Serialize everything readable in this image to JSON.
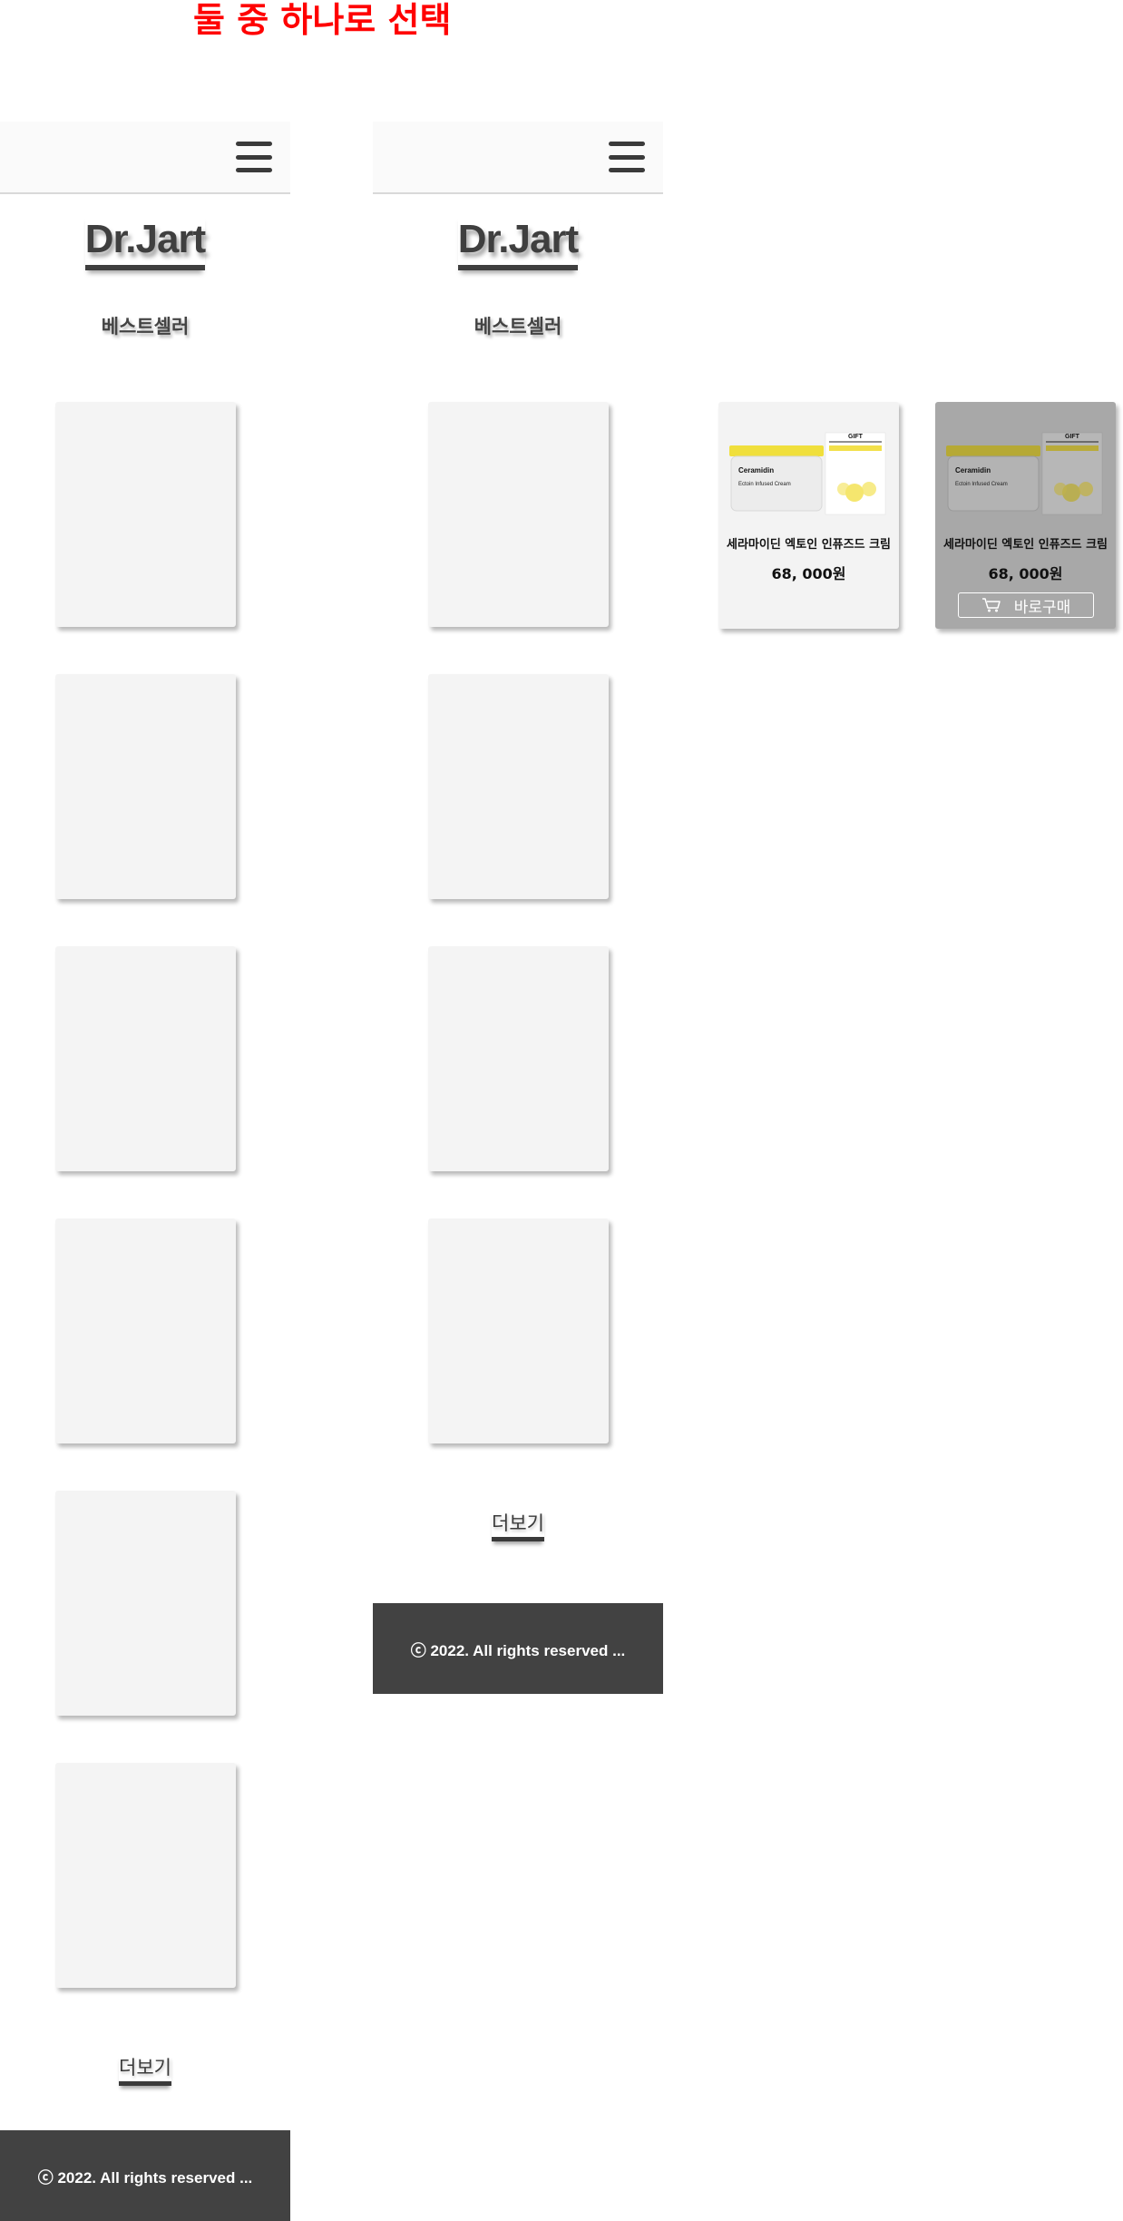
{
  "heading": "둘 중 하나로 선택",
  "mockups": [
    {
      "logo": "Dr.Jart",
      "section_title": "베스트셀러",
      "card_count": 6,
      "more_label": "더보기",
      "footer_text": "ⓒ 2022. All rights reserved ..."
    },
    {
      "logo": "Dr.Jart",
      "section_title": "베스트셀러",
      "card_count": 4,
      "more_label": "더보기",
      "footer_text": "ⓒ 2022. All rights reserved ..."
    }
  ],
  "product_cards": [
    {
      "state": "default",
      "image_brand": "Ceramidin",
      "image_product": "Ectoin Infused Cream",
      "image_gift": "GIFT",
      "name": "세라마이딘 엑토인 인퓨즈드 크림",
      "price": "68, 000원"
    },
    {
      "state": "hover",
      "image_brand": "Ceramidin",
      "image_product": "Ectoin Infused Cream",
      "image_gift": "GIFT",
      "name": "세라마이딘 엑토인 인퓨즈드 크림",
      "price": "68, 000원",
      "buy_label": "바로구매",
      "buy_icon": "cart-icon"
    }
  ],
  "colors": {
    "heading": "#ff0000",
    "footer_bg": "#424242",
    "card_bg": "#f4f4f4",
    "hover_overlay": "#a8a8a8"
  }
}
